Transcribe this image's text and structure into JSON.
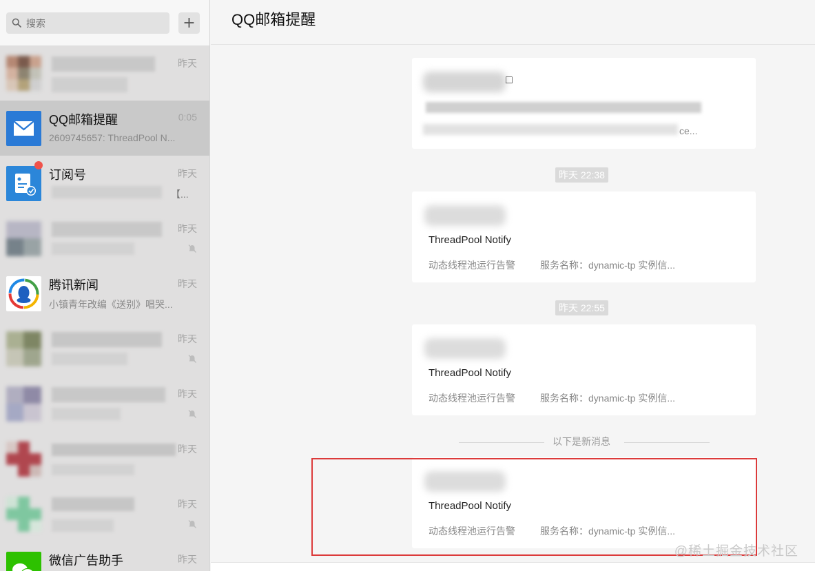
{
  "search": {
    "placeholder": "搜索"
  },
  "add_button": {
    "label": "+"
  },
  "chats": [
    {
      "title": "",
      "preview": "",
      "time": "昨天"
    },
    {
      "title": "QQ邮箱提醒",
      "preview": "2609745657: ThreadPool N...",
      "time": "0:05"
    },
    {
      "title": "订阅号",
      "preview": "【...",
      "time": "昨天"
    },
    {
      "title": "",
      "preview": "",
      "time": "昨天"
    },
    {
      "title": "腾讯新闻",
      "preview": "小镇青年改编《送别》唱哭...",
      "time": "昨天"
    },
    {
      "title": "",
      "preview": "",
      "time": "昨天"
    },
    {
      "title": "",
      "preview": "",
      "time": "昨天"
    },
    {
      "title": "",
      "preview": "",
      "time": "昨天"
    },
    {
      "title": "",
      "preview": "",
      "time": "昨天"
    },
    {
      "title": "微信广告助手",
      "preview": "",
      "time": "昨天"
    }
  ],
  "main": {
    "title": "QQ邮箱提醒",
    "cards": [
      {
        "notify": "",
        "row_left": "",
        "row_right": "ce..."
      },
      {
        "notify": "ThreadPool Notify",
        "row_left": "动态线程池运行告警",
        "row_right": "服务名称：dynamic-tp 实例信..."
      },
      {
        "notify": "ThreadPool Notify",
        "row_left": "动态线程池运行告警",
        "row_right": "服务名称：dynamic-tp 实例信..."
      },
      {
        "notify": "ThreadPool Notify",
        "row_left": "动态线程池运行告警",
        "row_right": "服务名称：dynamic-tp 实例信..."
      }
    ],
    "timestamps": [
      "昨天 22:38",
      "昨天 22:55"
    ],
    "new_messages_divider": "以下是新消息"
  },
  "watermark": "@稀土掘金技术社区",
  "colors": {
    "accent_red": "#dc3a3a",
    "badge_red": "#f0524a",
    "mail_blue": "#2a7ad6",
    "wechat_green": "#2dc100"
  }
}
